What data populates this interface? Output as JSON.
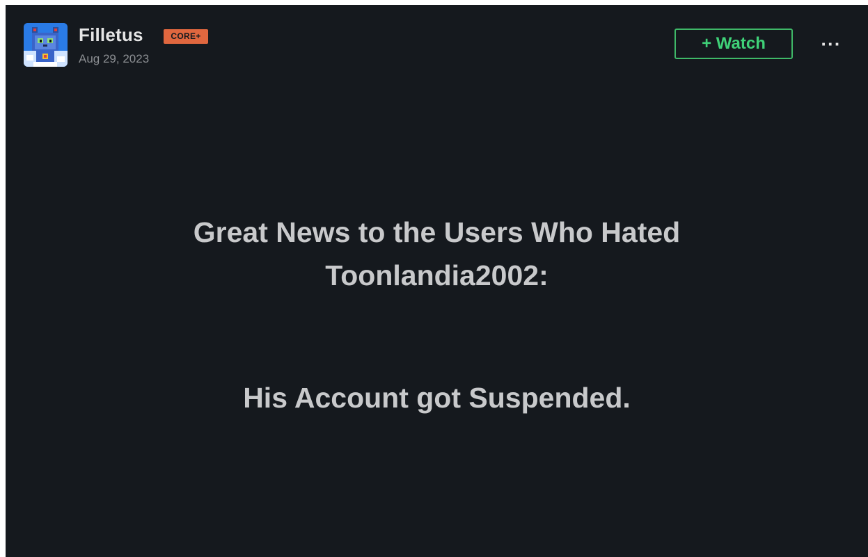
{
  "post": {
    "author": {
      "name": "Filletus",
      "badge": "CORE+",
      "avatar_icon": "pixel-cat-avatar"
    },
    "date": "Aug 29, 2023",
    "actions": {
      "watch_label": "+ Watch",
      "more_label": "···"
    },
    "body": {
      "line1": "Great News to the Users Who Hated",
      "line2": "Toonlandia2002:",
      "line3": "His Account got Suspended."
    }
  },
  "colors": {
    "background": "#15191e",
    "watch_accent": "#3fb868",
    "badge": "#e0673f",
    "text": "#c8c9cb"
  }
}
